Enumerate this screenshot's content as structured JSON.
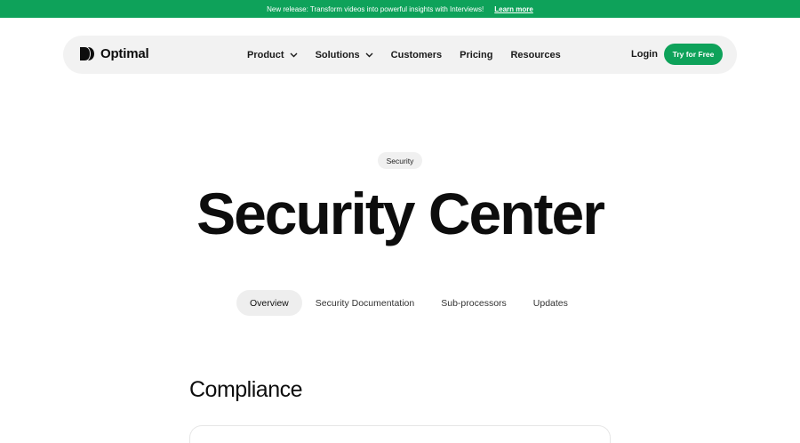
{
  "announcement": {
    "text": "New release: Transform videos into powerful insights with Interviews!",
    "link": "Learn more",
    "background": "#0ea25a"
  },
  "header": {
    "brand": "Optimal",
    "logo_icon": "optimal-logo-icon",
    "menu": [
      {
        "label": "Product",
        "has_dropdown": true
      },
      {
        "label": "Solutions",
        "has_dropdown": true
      },
      {
        "label": "Customers",
        "has_dropdown": false
      },
      {
        "label": "Pricing",
        "has_dropdown": false
      },
      {
        "label": "Resources",
        "has_dropdown": false
      }
    ],
    "login": "Login",
    "cta": "Try for Free",
    "accent": "#0ea25a"
  },
  "hero": {
    "badge": "Security",
    "title": "Security Center"
  },
  "tabs": [
    {
      "label": "Overview",
      "active": true
    },
    {
      "label": "Security Documentation",
      "active": false
    },
    {
      "label": "Sub-processors",
      "active": false
    },
    {
      "label": "Updates",
      "active": false
    }
  ],
  "section": {
    "title": "Compliance"
  }
}
